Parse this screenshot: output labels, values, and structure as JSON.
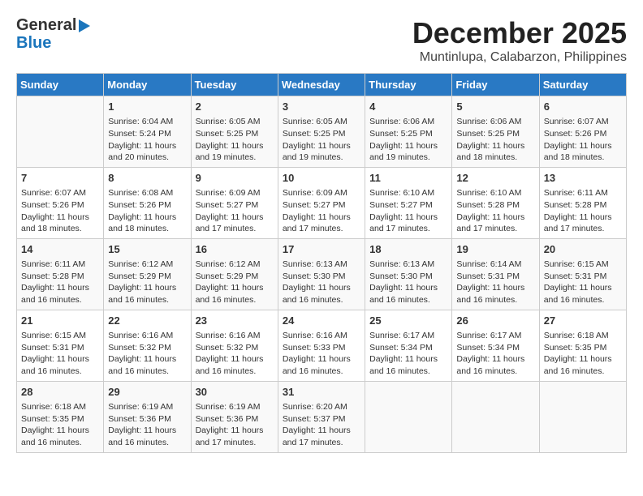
{
  "header": {
    "logo_general": "General",
    "logo_blue": "Blue",
    "title": "December 2025",
    "subtitle": "Muntinlupa, Calabarzon, Philippines"
  },
  "weekdays": [
    "Sunday",
    "Monday",
    "Tuesday",
    "Wednesday",
    "Thursday",
    "Friday",
    "Saturday"
  ],
  "rows": [
    [
      {
        "day": "",
        "info": ""
      },
      {
        "day": "1",
        "info": "Sunrise: 6:04 AM\nSunset: 5:24 PM\nDaylight: 11 hours\nand 20 minutes."
      },
      {
        "day": "2",
        "info": "Sunrise: 6:05 AM\nSunset: 5:25 PM\nDaylight: 11 hours\nand 19 minutes."
      },
      {
        "day": "3",
        "info": "Sunrise: 6:05 AM\nSunset: 5:25 PM\nDaylight: 11 hours\nand 19 minutes."
      },
      {
        "day": "4",
        "info": "Sunrise: 6:06 AM\nSunset: 5:25 PM\nDaylight: 11 hours\nand 19 minutes."
      },
      {
        "day": "5",
        "info": "Sunrise: 6:06 AM\nSunset: 5:25 PM\nDaylight: 11 hours\nand 18 minutes."
      },
      {
        "day": "6",
        "info": "Sunrise: 6:07 AM\nSunset: 5:26 PM\nDaylight: 11 hours\nand 18 minutes."
      }
    ],
    [
      {
        "day": "7",
        "info": "Sunrise: 6:07 AM\nSunset: 5:26 PM\nDaylight: 11 hours\nand 18 minutes."
      },
      {
        "day": "8",
        "info": "Sunrise: 6:08 AM\nSunset: 5:26 PM\nDaylight: 11 hours\nand 18 minutes."
      },
      {
        "day": "9",
        "info": "Sunrise: 6:09 AM\nSunset: 5:27 PM\nDaylight: 11 hours\nand 17 minutes."
      },
      {
        "day": "10",
        "info": "Sunrise: 6:09 AM\nSunset: 5:27 PM\nDaylight: 11 hours\nand 17 minutes."
      },
      {
        "day": "11",
        "info": "Sunrise: 6:10 AM\nSunset: 5:27 PM\nDaylight: 11 hours\nand 17 minutes."
      },
      {
        "day": "12",
        "info": "Sunrise: 6:10 AM\nSunset: 5:28 PM\nDaylight: 11 hours\nand 17 minutes."
      },
      {
        "day": "13",
        "info": "Sunrise: 6:11 AM\nSunset: 5:28 PM\nDaylight: 11 hours\nand 17 minutes."
      }
    ],
    [
      {
        "day": "14",
        "info": "Sunrise: 6:11 AM\nSunset: 5:28 PM\nDaylight: 11 hours\nand 16 minutes."
      },
      {
        "day": "15",
        "info": "Sunrise: 6:12 AM\nSunset: 5:29 PM\nDaylight: 11 hours\nand 16 minutes."
      },
      {
        "day": "16",
        "info": "Sunrise: 6:12 AM\nSunset: 5:29 PM\nDaylight: 11 hours\nand 16 minutes."
      },
      {
        "day": "17",
        "info": "Sunrise: 6:13 AM\nSunset: 5:30 PM\nDaylight: 11 hours\nand 16 minutes."
      },
      {
        "day": "18",
        "info": "Sunrise: 6:13 AM\nSunset: 5:30 PM\nDaylight: 11 hours\nand 16 minutes."
      },
      {
        "day": "19",
        "info": "Sunrise: 6:14 AM\nSunset: 5:31 PM\nDaylight: 11 hours\nand 16 minutes."
      },
      {
        "day": "20",
        "info": "Sunrise: 6:15 AM\nSunset: 5:31 PM\nDaylight: 11 hours\nand 16 minutes."
      }
    ],
    [
      {
        "day": "21",
        "info": "Sunrise: 6:15 AM\nSunset: 5:31 PM\nDaylight: 11 hours\nand 16 minutes."
      },
      {
        "day": "22",
        "info": "Sunrise: 6:16 AM\nSunset: 5:32 PM\nDaylight: 11 hours\nand 16 minutes."
      },
      {
        "day": "23",
        "info": "Sunrise: 6:16 AM\nSunset: 5:32 PM\nDaylight: 11 hours\nand 16 minutes."
      },
      {
        "day": "24",
        "info": "Sunrise: 6:16 AM\nSunset: 5:33 PM\nDaylight: 11 hours\nand 16 minutes."
      },
      {
        "day": "25",
        "info": "Sunrise: 6:17 AM\nSunset: 5:34 PM\nDaylight: 11 hours\nand 16 minutes."
      },
      {
        "day": "26",
        "info": "Sunrise: 6:17 AM\nSunset: 5:34 PM\nDaylight: 11 hours\nand 16 minutes."
      },
      {
        "day": "27",
        "info": "Sunrise: 6:18 AM\nSunset: 5:35 PM\nDaylight: 11 hours\nand 16 minutes."
      }
    ],
    [
      {
        "day": "28",
        "info": "Sunrise: 6:18 AM\nSunset: 5:35 PM\nDaylight: 11 hours\nand 16 minutes."
      },
      {
        "day": "29",
        "info": "Sunrise: 6:19 AM\nSunset: 5:36 PM\nDaylight: 11 hours\nand 16 minutes."
      },
      {
        "day": "30",
        "info": "Sunrise: 6:19 AM\nSunset: 5:36 PM\nDaylight: 11 hours\nand 17 minutes."
      },
      {
        "day": "31",
        "info": "Sunrise: 6:20 AM\nSunset: 5:37 PM\nDaylight: 11 hours\nand 17 minutes."
      },
      {
        "day": "",
        "info": ""
      },
      {
        "day": "",
        "info": ""
      },
      {
        "day": "",
        "info": ""
      }
    ]
  ]
}
